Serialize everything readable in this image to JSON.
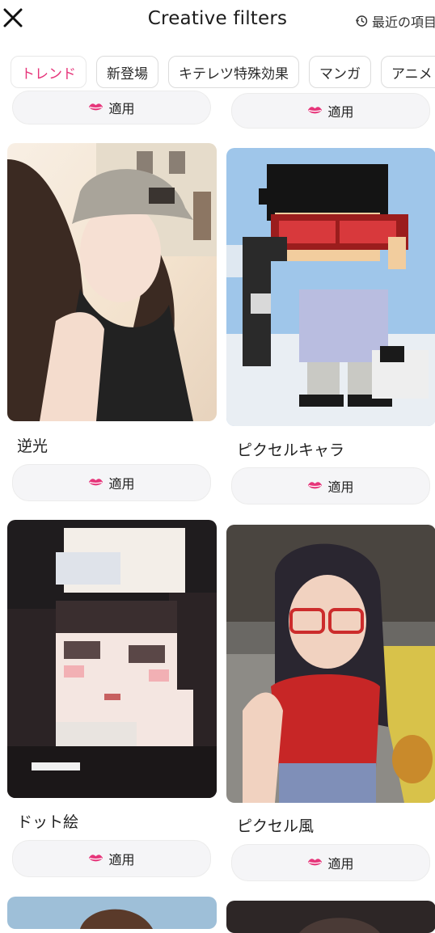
{
  "header": {
    "title": "Creative filters",
    "recent_label": "最近の項目"
  },
  "tabs": [
    {
      "label": "トレンド",
      "active": true
    },
    {
      "label": "新登場",
      "active": false
    },
    {
      "label": "キテレツ特殊効果",
      "active": false
    },
    {
      "label": "マンガ",
      "active": false
    },
    {
      "label": "アニメ",
      "active": false
    }
  ],
  "apply_label": "適用",
  "cards": [
    {
      "title": "逆光",
      "image": "anime-girl-bucket-hat-photo"
    },
    {
      "title": "ピクセルキャラ",
      "image": "pixel-boy-snowboard-photo"
    },
    {
      "title": "ドット絵",
      "image": "pixel-anime-girl-photo"
    },
    {
      "title": "ピクセル風",
      "image": "pixel-girl-red-glasses-photo"
    }
  ],
  "colors": {
    "accent": "#e6357a",
    "chip_border": "#dcdcdc",
    "button_bg": "#f5f5f7"
  },
  "icons": {
    "close": "close-icon",
    "history": "history-icon",
    "apply": "lips-icon"
  }
}
